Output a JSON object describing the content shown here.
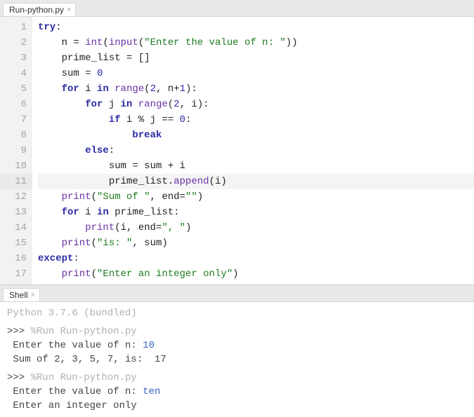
{
  "editor_tab": {
    "label": "Run-python.py"
  },
  "shell_tab": {
    "label": "Shell"
  },
  "code_lines": [
    {
      "n": 1,
      "indent": "",
      "tokens": [
        [
          "kw",
          "try"
        ],
        [
          "pun",
          ":"
        ]
      ]
    },
    {
      "n": 2,
      "indent": "    ",
      "tokens": [
        [
          "op",
          "n = "
        ],
        [
          "fn",
          "int"
        ],
        [
          "pun",
          "("
        ],
        [
          "fn",
          "input"
        ],
        [
          "pun",
          "("
        ],
        [
          "str",
          "\"Enter the value of n: \""
        ],
        [
          "pun",
          ")"
        ],
        [
          "pun",
          ")"
        ]
      ]
    },
    {
      "n": 3,
      "indent": "    ",
      "tokens": [
        [
          "op",
          "prime_list = []"
        ]
      ]
    },
    {
      "n": 4,
      "indent": "    ",
      "tokens": [
        [
          "op",
          "sum = "
        ],
        [
          "num",
          "0"
        ]
      ]
    },
    {
      "n": 5,
      "indent": "    ",
      "tokens": [
        [
          "kw",
          "for"
        ],
        [
          "op",
          " i "
        ],
        [
          "kw",
          "in"
        ],
        [
          "op",
          " "
        ],
        [
          "fn",
          "range"
        ],
        [
          "pun",
          "("
        ],
        [
          "num",
          "2"
        ],
        [
          "pun",
          ", n+"
        ],
        [
          "num",
          "1"
        ],
        [
          "pun",
          "):"
        ]
      ]
    },
    {
      "n": 6,
      "indent": "        ",
      "tokens": [
        [
          "kw",
          "for"
        ],
        [
          "op",
          " j "
        ],
        [
          "kw",
          "in"
        ],
        [
          "op",
          " "
        ],
        [
          "fn",
          "range"
        ],
        [
          "pun",
          "("
        ],
        [
          "num",
          "2"
        ],
        [
          "pun",
          ", i):"
        ]
      ]
    },
    {
      "n": 7,
      "indent": "            ",
      "tokens": [
        [
          "kw",
          "if"
        ],
        [
          "op",
          " i % j == "
        ],
        [
          "num",
          "0"
        ],
        [
          "pun",
          ":"
        ]
      ]
    },
    {
      "n": 8,
      "indent": "                ",
      "tokens": [
        [
          "kw",
          "break"
        ]
      ]
    },
    {
      "n": 9,
      "indent": "        ",
      "tokens": [
        [
          "kw",
          "else"
        ],
        [
          "pun",
          ":"
        ]
      ]
    },
    {
      "n": 10,
      "indent": "            ",
      "tokens": [
        [
          "op",
          "sum = sum + i"
        ]
      ]
    },
    {
      "n": 11,
      "indent": "            ",
      "hl": true,
      "tokens": [
        [
          "op",
          "prime_list."
        ],
        [
          "fn",
          "append"
        ],
        [
          "pun",
          "(i)"
        ]
      ]
    },
    {
      "n": 12,
      "indent": "    ",
      "tokens": [
        [
          "fn",
          "print"
        ],
        [
          "pun",
          "("
        ],
        [
          "str",
          "\"Sum of \""
        ],
        [
          "pun",
          ", end="
        ],
        [
          "str",
          "\"\""
        ],
        [
          "pun",
          ")"
        ]
      ]
    },
    {
      "n": 13,
      "indent": "    ",
      "tokens": [
        [
          "kw",
          "for"
        ],
        [
          "op",
          " i "
        ],
        [
          "kw",
          "in"
        ],
        [
          "op",
          " prime_list:"
        ]
      ]
    },
    {
      "n": 14,
      "indent": "        ",
      "tokens": [
        [
          "fn",
          "print"
        ],
        [
          "pun",
          "(i, end="
        ],
        [
          "str",
          "\", \""
        ],
        [
          "pun",
          ")"
        ]
      ]
    },
    {
      "n": 15,
      "indent": "    ",
      "tokens": [
        [
          "fn",
          "print"
        ],
        [
          "pun",
          "("
        ],
        [
          "str",
          "\"is: \""
        ],
        [
          "pun",
          ", sum)"
        ]
      ]
    },
    {
      "n": 16,
      "indent": "",
      "tokens": [
        [
          "kw",
          "except"
        ],
        [
          "pun",
          ":"
        ]
      ]
    },
    {
      "n": 17,
      "indent": "    ",
      "tokens": [
        [
          "fn",
          "print"
        ],
        [
          "pun",
          "("
        ],
        [
          "str",
          "\"Enter an integer only\""
        ],
        [
          "pun",
          ")"
        ]
      ]
    }
  ],
  "shell_lines": [
    {
      "cls": "sh-dim",
      "prefix": "",
      "text": "Python 3.7.6 (bundled)"
    },
    {
      "cls": "sh-prompt",
      "prefix": ">>> ",
      "text": "%Run Run-python.py"
    },
    {
      "cls": "sh-text",
      "prefix": "",
      "text": " Enter the value of n: ",
      "tail": "10",
      "tail_cls": "sh-input"
    },
    {
      "cls": "sh-text",
      "prefix": "",
      "text": " Sum of 2, 3, 5, 7, is:  17"
    },
    {
      "cls": "sh-prompt",
      "prefix": ">>> ",
      "text": "%Run Run-python.py"
    },
    {
      "cls": "sh-text",
      "prefix": "",
      "text": " Enter the value of n: ",
      "tail": "ten",
      "tail_cls": "sh-input"
    },
    {
      "cls": "sh-text",
      "prefix": "",
      "text": " Enter an integer only"
    }
  ]
}
